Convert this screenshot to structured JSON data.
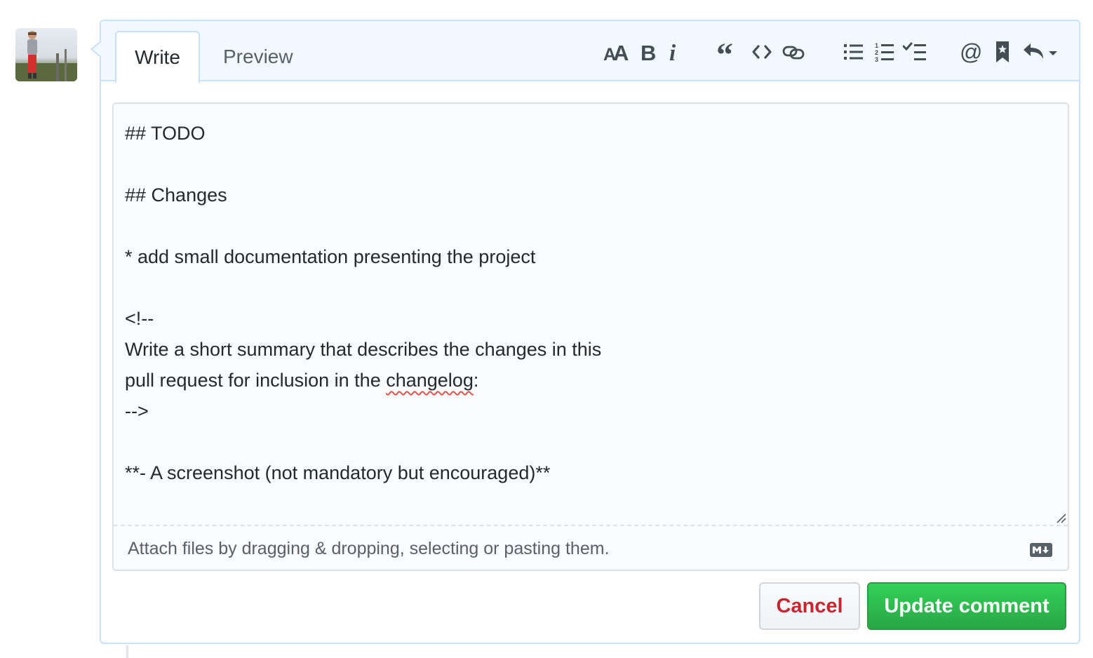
{
  "tabs": {
    "write": "Write",
    "preview": "Preview"
  },
  "toolbar": {
    "items": [
      {
        "name": "header-text-icon",
        "label": "AA"
      },
      {
        "name": "bold-icon",
        "label": "B"
      },
      {
        "name": "italic-icon",
        "label": "i"
      },
      {
        "name": "quote-icon"
      },
      {
        "name": "code-icon"
      },
      {
        "name": "link-icon"
      },
      {
        "name": "unordered-list-icon"
      },
      {
        "name": "ordered-list-icon"
      },
      {
        "name": "task-list-icon"
      },
      {
        "name": "mention-icon",
        "label": "@"
      },
      {
        "name": "bookmark-icon"
      },
      {
        "name": "reply-icon"
      }
    ]
  },
  "editor": {
    "lines": [
      "## TODO",
      "",
      "## Changes",
      "",
      "* add small documentation presenting the project",
      "",
      "<!--",
      "Write a short summary that describes the changes in this",
      "pull request for inclusion in the changelog:",
      "-->",
      "",
      "**- A screenshot (not mandatory but encouraged)**"
    ],
    "misspelled_word": "changelog",
    "attach_hint": "Attach files by dragging & dropping, selecting or pasting them.",
    "markdown_badge": "markdown-icon"
  },
  "actions": {
    "cancel": "Cancel",
    "update": "Update comment"
  },
  "colors": {
    "header_bg": "#f1f8ff",
    "border": "#c8e1ff",
    "cancel_text": "#cb2431",
    "primary": "#28a745"
  }
}
